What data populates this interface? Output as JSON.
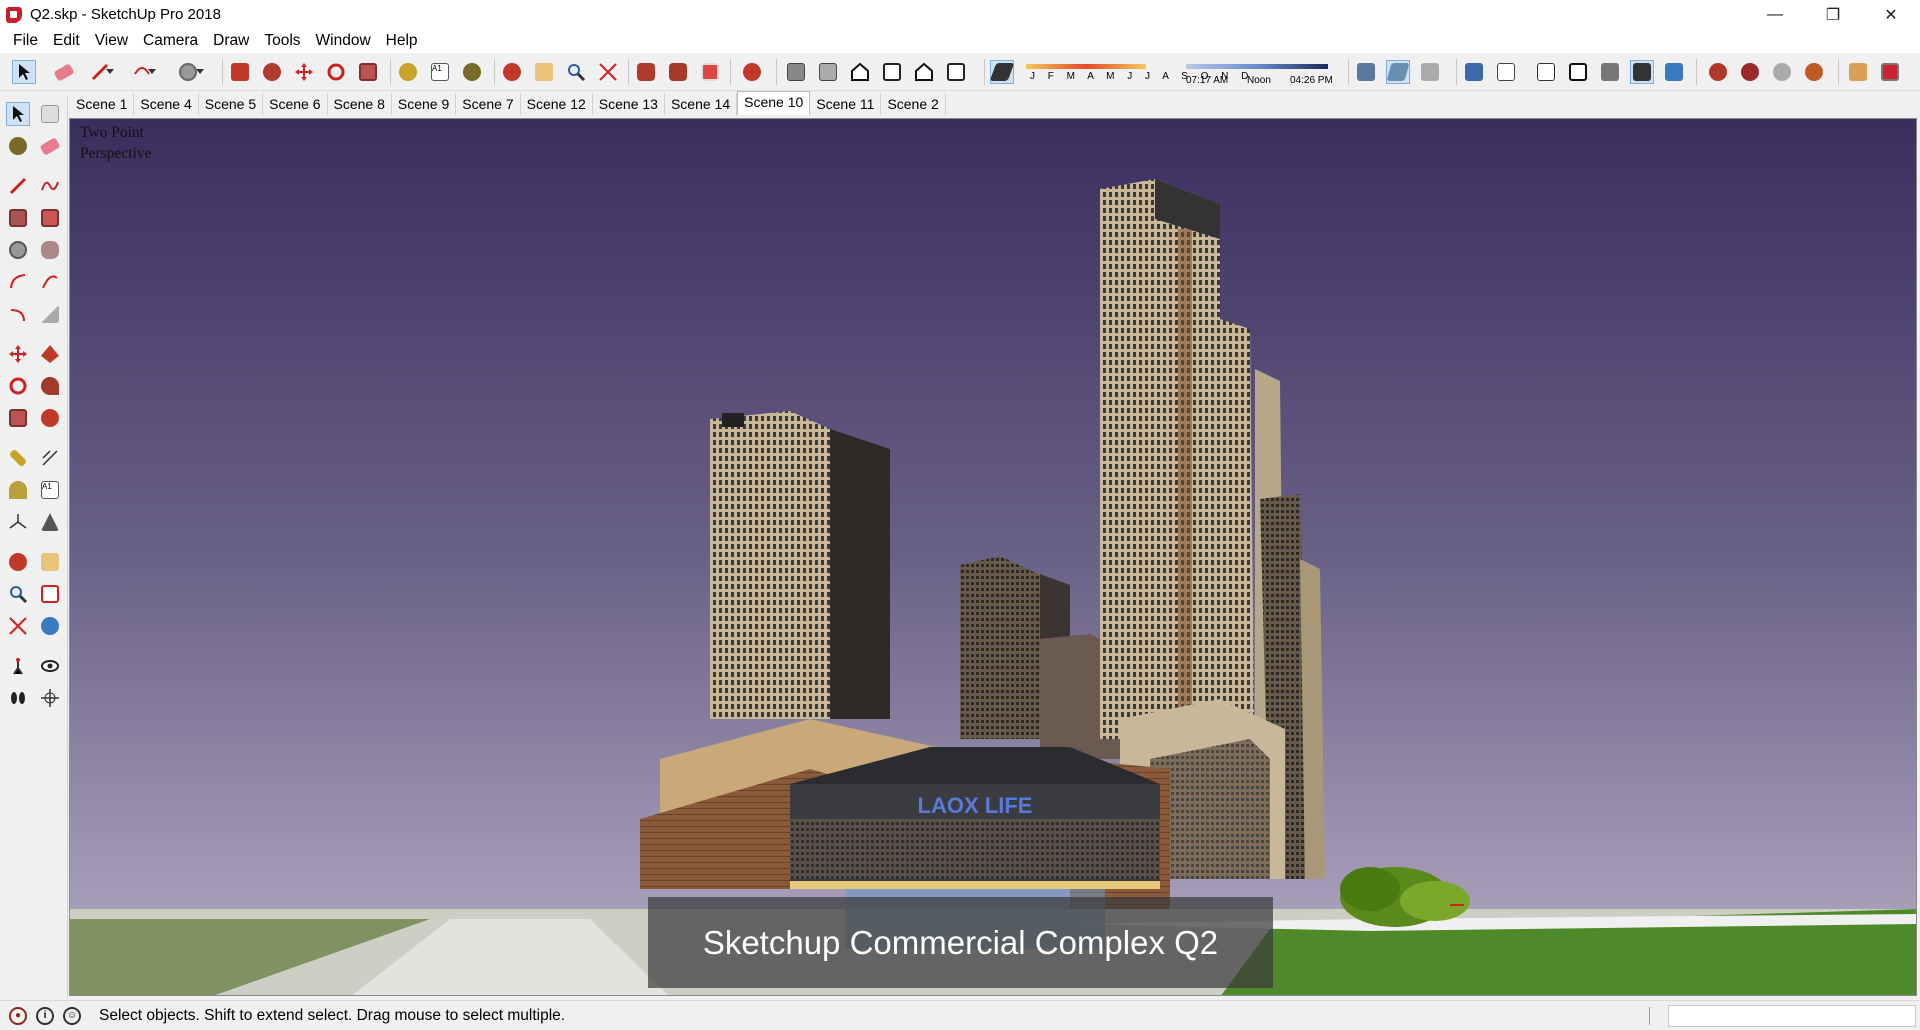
{
  "window": {
    "title": "Q2.skp - SketchUp Pro 2018",
    "minimize": "—",
    "maximize": "❐",
    "close": "✕"
  },
  "menu": [
    "File",
    "Edit",
    "View",
    "Camera",
    "Draw",
    "Tools",
    "Window",
    "Help"
  ],
  "shadow": {
    "months": "J F M A M J J A S O N D",
    "time_start": "07:17 AM",
    "time_mid": "Noon",
    "time_end": "04:26 PM"
  },
  "scenes": [
    "Scene 1",
    "Scene 4",
    "Scene 5",
    "Scene 6",
    "Scene 8",
    "Scene 9",
    "Scene 7",
    "Scene 12",
    "Scene 13",
    "Scene 14",
    "Scene 10",
    "Scene 11",
    "Scene 2"
  ],
  "active_scene": "Scene 10",
  "viewport": {
    "view_label_1": "Two Point",
    "view_label_2": "Perspective",
    "caption": "Sketchup Commercial Complex Q2",
    "sign": "LAOX LIFE"
  },
  "status": {
    "text": "Select objects. Shift to extend select. Drag mouse to select multiple."
  },
  "colors": {
    "sky_top": "#3a2e5e",
    "sky_bottom": "#b6aec4",
    "grass": "#4e8a2a",
    "building_brick": "#8a5a3a",
    "building_beige": "#c9b79a"
  }
}
